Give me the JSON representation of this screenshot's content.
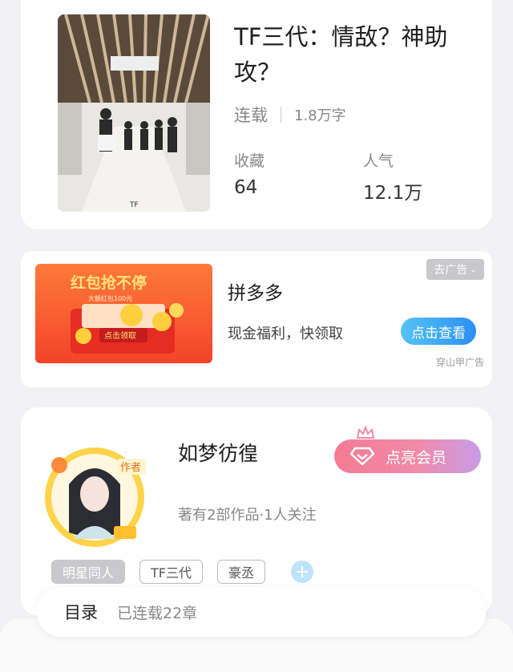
{
  "book": {
    "title": "TF三代：情敌？神助攻？",
    "status": "连载",
    "word_count": "1.8万字",
    "favorites_label": "收藏",
    "favorites_value": "64",
    "popularity_label": "人气",
    "popularity_value": "12.1万",
    "cover_text": "TF"
  },
  "ad": {
    "image_text": "红包抢不停",
    "image_subtext": "大额红包100元",
    "image_button": "点击领取",
    "title": "拼多多",
    "description": "现金福利，快领取",
    "cta_label": "点击查看",
    "close_label": "去广告",
    "source": "穿山甲广告"
  },
  "author": {
    "name": "如梦彷徨",
    "works": "著有2部作品·1人关注",
    "badge_text": "作者",
    "vip_label": "点亮会员",
    "tags": [
      "明星同人",
      "TF三代",
      "豪丞"
    ]
  },
  "toc": {
    "title": "目录",
    "chapter_count": "已连载22章"
  }
}
